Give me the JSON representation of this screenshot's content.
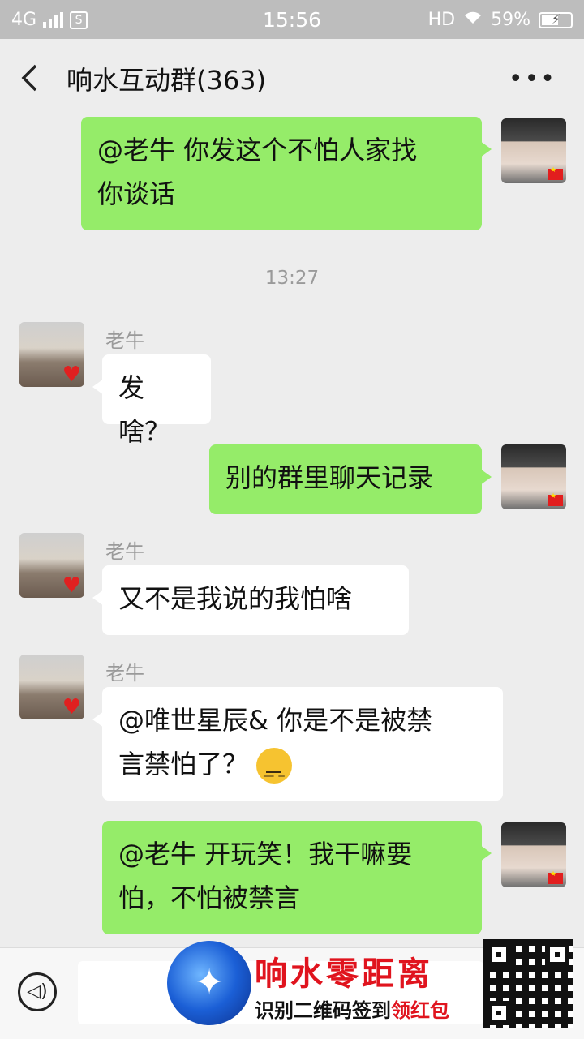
{
  "status_bar": {
    "network": "4G",
    "time": "15:56",
    "hd": "HD",
    "battery": "59%",
    "battery_level": 0.59
  },
  "header": {
    "title": "响水互动群(363)"
  },
  "messages": [
    {
      "from": "me",
      "text_lines": [
        "@老牛  你发这个不怕人家找",
        "你谈话"
      ]
    },
    {
      "type": "timestamp",
      "text": "13:27"
    },
    {
      "from": "other",
      "sender": "老牛",
      "text": "发啥？"
    },
    {
      "from": "me",
      "text": "别的群里聊天记录"
    },
    {
      "from": "other",
      "sender": "老牛",
      "text": "又不是我说的我怕啥"
    },
    {
      "from": "other",
      "sender": "老牛",
      "text_lines": [
        "@唯世星辰&  你是不是被禁",
        "言禁怕了？"
      ],
      "emoji": "smirk-emoji"
    },
    {
      "from": "me",
      "text_lines": [
        "@老牛  开玩笑！我干嘛要",
        "怕，不怕被禁言"
      ]
    }
  ],
  "promo": {
    "title": "响水零距离",
    "subtitle_main": "识别二维码签到",
    "subtitle_red": "领红包"
  },
  "icons": {
    "back": "chevron-left-icon",
    "more": "more-icon",
    "voice": "voice-icon"
  }
}
